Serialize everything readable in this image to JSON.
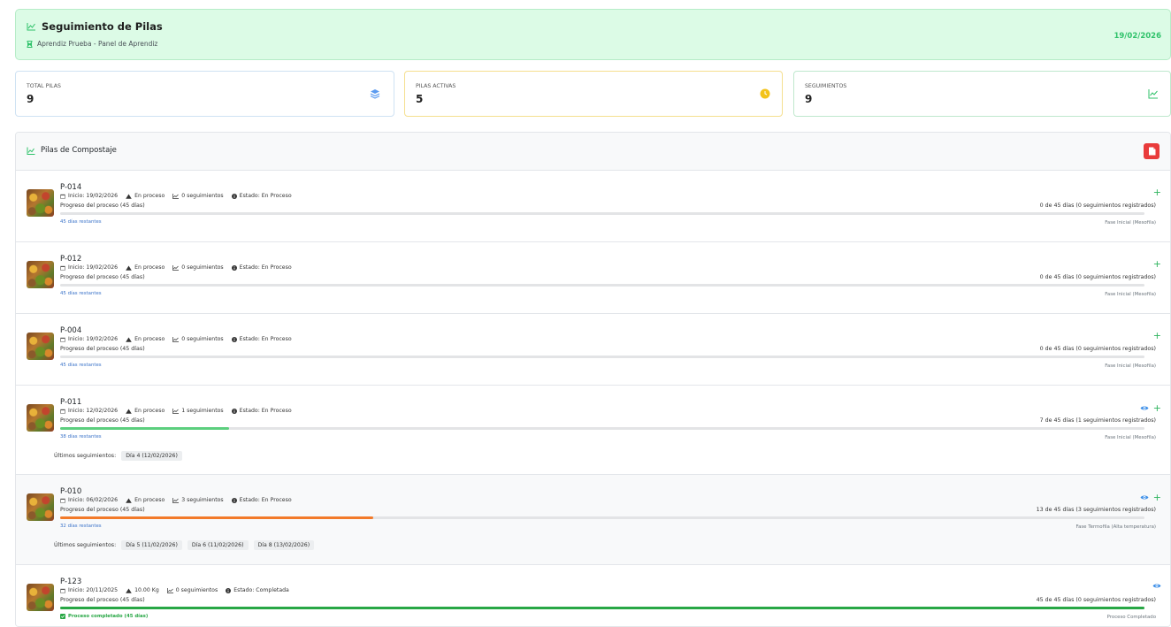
{
  "header": {
    "title": "Seguimiento de Pilas",
    "subtitle": "Aprendiz Prueba - Panel de Aprendiz",
    "date": "19/02/2026"
  },
  "stats": [
    {
      "label": "TOTAL PILAS",
      "value": "9",
      "icon": "layers-icon",
      "color": "#5b9bf0"
    },
    {
      "label": "PILAS ACTIVAS",
      "value": "5",
      "icon": "clock-icon",
      "color": "#f3c31a"
    },
    {
      "label": "SEGUIMIENTOS",
      "value": "9",
      "icon": "chart-line-icon",
      "color": "#2fc26a"
    }
  ],
  "panel": {
    "title": "Pilas de Compostaje",
    "export_icon": "file-pdf-icon"
  },
  "ultimos_label": "Últimos seguimientos:",
  "piles": [
    {
      "id": "P-014",
      "inicio": "Inicio: 19/02/2026",
      "estado_corto": "En proceso",
      "seguimientos": "0 seguimientos",
      "estado": "Estado: En Proceso",
      "progreso": "Progreso del proceso (45 días)",
      "resumen": "0 de 45 días (0 seguimientos registrados)",
      "restantes": "45 días restantes",
      "fase": "Fase Inicial (Mesofila)",
      "progress": 0,
      "bar_color": "#2fc26a",
      "actions": [
        "add"
      ],
      "ultimos": []
    },
    {
      "id": "P-012",
      "inicio": "Inicio: 19/02/2026",
      "estado_corto": "En proceso",
      "seguimientos": "0 seguimientos",
      "estado": "Estado: En Proceso",
      "progreso": "Progreso del proceso (45 días)",
      "resumen": "0 de 45 días (0 seguimientos registrados)",
      "restantes": "45 días restantes",
      "fase": "Fase Inicial (Mesofila)",
      "progress": 0,
      "bar_color": "#2fc26a",
      "actions": [
        "add"
      ],
      "ultimos": []
    },
    {
      "id": "P-004",
      "inicio": "Inicio: 19/02/2026",
      "estado_corto": "En proceso",
      "seguimientos": "0 seguimientos",
      "estado": "Estado: En Proceso",
      "progreso": "Progreso del proceso (45 días)",
      "resumen": "0 de 45 días (0 seguimientos registrados)",
      "restantes": "45 días restantes",
      "fase": "Fase Inicial (Mesofila)",
      "progress": 0,
      "bar_color": "#2fc26a",
      "actions": [
        "add"
      ],
      "ultimos": []
    },
    {
      "id": "P-011",
      "inicio": "Inicio: 12/02/2026",
      "estado_corto": "En proceso",
      "seguimientos": "1 seguimientos",
      "estado": "Estado: En Proceso",
      "progreso": "Progreso del proceso (45 días)",
      "resumen": "7 de 45 días (1 seguimientos registrados)",
      "restantes": "38 días restantes",
      "fase": "Fase Inicial (Mesofila)",
      "progress": 0.156,
      "bar_color": "#5ccf7e",
      "actions": [
        "view",
        "add"
      ],
      "ultimos": [
        "Día 4 (12/02/2026)"
      ]
    },
    {
      "id": "P-010",
      "inicio": "Inicio: 06/02/2026",
      "estado_corto": "En proceso",
      "seguimientos": "3 seguimientos",
      "estado": "Estado: En Proceso",
      "progreso": "Progreso del proceso (45 días)",
      "resumen": "13 de 45 días (3 seguimientos registrados)",
      "restantes": "32 días restantes",
      "fase": "Fase Termofila (Alta temperatura)",
      "progress": 0.289,
      "bar_color": "#f27a2a",
      "actions": [
        "view",
        "add"
      ],
      "ultimos": [
        "Día 5 (11/02/2026)",
        "Día 6 (11/02/2026)",
        "Día 8 (13/02/2026)"
      ]
    },
    {
      "id": "P-123",
      "inicio": "Inicio: 20/11/2025",
      "estado_corto": "10.00 Kg",
      "seguimientos": "0 seguimientos",
      "estado": "Estado: Completada",
      "progreso": "Progreso del proceso (45 días)",
      "resumen": "45 de 45 días (0 seguimientos registrados)",
      "restantes": "Proceso completado (45 días)",
      "fase": "Proceso Completado",
      "progress": 1,
      "bar_color": "#28a745",
      "actions": [
        "view"
      ],
      "ultimos": []
    }
  ]
}
